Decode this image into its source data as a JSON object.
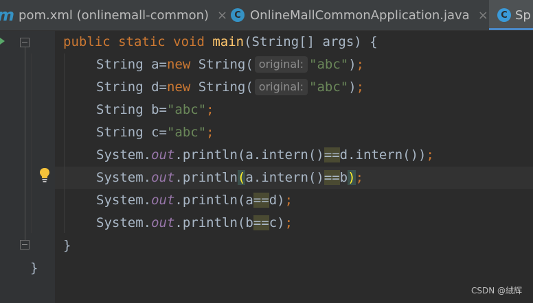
{
  "tabs": [
    {
      "icon": "maven-m-icon",
      "glyph": "m",
      "label": "pom.xml (onlinemall-common)",
      "close": "×"
    },
    {
      "icon": "class-c-icon",
      "glyph": "C",
      "label": "OnlineMallCommonApplication.java",
      "close": "×"
    },
    {
      "icon": "spring-class-icon",
      "glyph": "C",
      "label": "Sp",
      "active": true
    }
  ],
  "code": {
    "l1": {
      "mods": "public static void ",
      "name": "main",
      "rest": "(String[] args) {"
    },
    "l2": {
      "a": "String a=",
      "kw": "new",
      "b": " String(",
      "hint": "original:",
      "s": "\"abc\"",
      "c": ")",
      "semi": ";"
    },
    "l3": {
      "a": "String d=",
      "kw": "new",
      "b": " String(",
      "hint": "original:",
      "s": "\"abc\"",
      "c": ")",
      "semi": ";"
    },
    "l4": {
      "a": "String b=",
      "s": "\"abc\"",
      "semi": ";"
    },
    "l5": {
      "a": "String c=",
      "s": "\"abc\"",
      "semi": ";"
    },
    "l6": {
      "a": "System.",
      "f": "out",
      "b": ".println(a.intern()",
      "eq": "==",
      "c": "d.intern())",
      "semi": ";"
    },
    "l7": {
      "a": "System.",
      "f": "out",
      "b": ".println",
      "p1": "(",
      "c": "a.intern()",
      "eq": "==",
      "d": "b",
      "p2": ")",
      "semi": ";"
    },
    "l8": {
      "a": "System.",
      "f": "out",
      "b": ".println(a",
      "eq": "==",
      "c": "d)",
      "semi": ";"
    },
    "l9": {
      "a": "System.",
      "f": "out",
      "b": ".println(b",
      "eq": "==",
      "c": "c)",
      "semi": ";"
    },
    "l10": "}",
    "l11": "}"
  },
  "gutter": {
    "intention_icon": "lightbulb-icon",
    "run_icon": "run-arrow-icon"
  },
  "watermark": "CSDN @絨辉",
  "colors": {
    "background": "#2b2b2b",
    "keyword": "#cc7832",
    "method": "#ffc66d",
    "string": "#6a8759",
    "static_field": "#9876aa",
    "text": "#a9b7c6"
  }
}
